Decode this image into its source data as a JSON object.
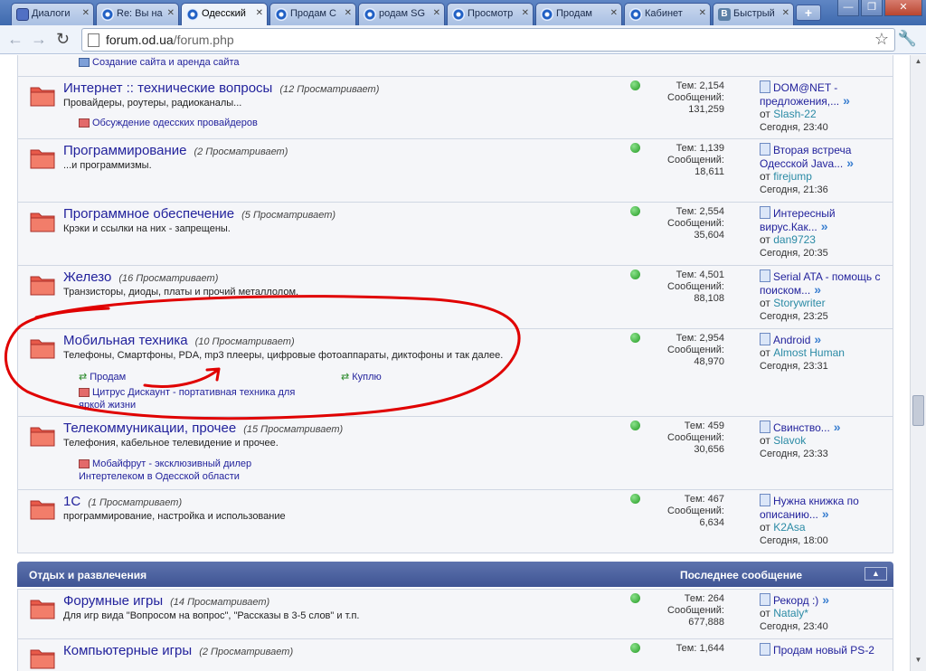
{
  "tabs": [
    {
      "label": "Диалоги",
      "icon": "dialog-icon"
    },
    {
      "label": "Re: Вы на",
      "icon": "site-icon"
    },
    {
      "label": "Одесский",
      "icon": "site-icon",
      "active": true
    },
    {
      "label": "Продам С",
      "icon": "site-icon"
    },
    {
      "label": "родам SG",
      "icon": "site-icon"
    },
    {
      "label": "Просмотр",
      "icon": "site-icon"
    },
    {
      "label": "Продам",
      "icon": "site-icon"
    },
    {
      "label": "Кабинет",
      "icon": "site-icon"
    },
    {
      "label": "Быстрый",
      "icon": "vk-icon",
      "badge": "B"
    }
  ],
  "new_tab_label": "+",
  "address": {
    "host": "forum.od.ua",
    "path": "/forum.php"
  },
  "top_sub": {
    "label": "Создание сайта и аренда сайта"
  },
  "forums": [
    {
      "title": "Интернет :: технические вопросы",
      "viewers": "(12 Просматривает)",
      "desc": "Провайдеры, роутеры, радиоканалы...",
      "subs": [
        {
          "label": "Обсуждение одесских провайдеров"
        }
      ],
      "topics": "Тем: 2,154",
      "posts_label": "Сообщений:",
      "posts": "131,259",
      "last_title": "DOM@NET - предложения,...",
      "last_by": "от",
      "last_user": "Slash-22",
      "last_time": "Сегодня, 23:40"
    },
    {
      "title": "Программирование",
      "viewers": "(2 Просматривает)",
      "desc": "...и программизмы.",
      "topics": "Тем: 1,139",
      "posts_label": "Сообщений:",
      "posts": "18,611",
      "last_title": "Вторая встреча Одесской Java...",
      "last_by": "от",
      "last_user": "firejump",
      "last_time": "Сегодня, 21:36"
    },
    {
      "title": "Программное обеспечение",
      "viewers": "(5 Просматривает)",
      "desc": "Крэки и ссылки на них - запрещены.",
      "topics": "Тем: 2,554",
      "posts_label": "Сообщений:",
      "posts": "35,604",
      "last_title": "Интересный вирус.Как...",
      "last_by": "от",
      "last_user": "dan9723",
      "last_time": "Сегодня, 20:35"
    },
    {
      "title": "Железо",
      "viewers": "(16 Просматривает)",
      "desc": "Транзисторы, диоды, платы и прочий металлолом.",
      "topics": "Тем: 4,501",
      "posts_label": "Сообщений:",
      "posts": "88,108",
      "last_title": "Serial ATA - помощь с поиском...",
      "last_by": "от",
      "last_user": "Storywriter",
      "last_time": "Сегодня, 23:25"
    },
    {
      "title": "Мобильная техника",
      "viewers": "(10 Просматривает)",
      "desc": "Телефоны, Смартфоны, PDA, mp3 плееры, цифровые фотоаппараты, диктофоны и так далее.",
      "sub_sell": "Продам",
      "sub_buy": "Куплю",
      "sub_shop_1": "Цитрус Дискаунт - портативная техника для",
      "sub_shop_2": "яркой жизни",
      "topics": "Тем: 2,954",
      "posts_label": "Сообщений:",
      "posts": "48,970",
      "last_title": "Android",
      "last_by": "от",
      "last_user": "Almost Human",
      "last_time": "Сегодня, 23:31"
    },
    {
      "title": "Телекоммуникации, прочее",
      "viewers": "(15 Просматривает)",
      "desc": "Телефония, кабельное телевидение и прочее.",
      "sub_shop_1": "Мобайфрут - эксклюзивный дилер",
      "sub_shop_2": "Интертелеком в Одесской области",
      "topics": "Тем: 459",
      "posts_label": "Сообщений:",
      "posts": "30,656",
      "last_title": "Свинство...",
      "last_by": "от",
      "last_user": "Slavok",
      "last_time": "Сегодня, 23:33"
    },
    {
      "title": "1С",
      "viewers": "(1 Просматривает)",
      "desc": "программирование, настройка и использование",
      "topics": "Тем: 467",
      "posts_label": "Сообщений:",
      "posts": "6,634",
      "last_title": "Нужна книжка по описанию...",
      "last_by": "от",
      "last_user": "K2Asa",
      "last_time": "Сегодня, 18:00"
    }
  ],
  "category": {
    "title": "Отдых и развлечения",
    "last_post_label": "Последнее сообщение"
  },
  "forums2": [
    {
      "title": "Форумные игры",
      "viewers": "(14 Просматривает)",
      "desc": "Для игр вида \"Вопросом на вопрос\", \"Рассказы в 3-5 слов\" и т.п.",
      "topics": "Тем: 264",
      "posts_label": "Сообщений:",
      "posts": "677,888",
      "last_title": "Рекорд :)",
      "last_by": "от",
      "last_user": "Nataly*",
      "last_time": "Сегодня, 23:40"
    },
    {
      "title": "Компьютерные игры",
      "viewers": "(2 Просматривает)",
      "topics": "Тем: 1,644",
      "last_title": "Продам новый PS-2"
    }
  ],
  "colors": {
    "link": "#22229c",
    "category_bar": "#4a5f9e",
    "annotation": "#e00000"
  }
}
